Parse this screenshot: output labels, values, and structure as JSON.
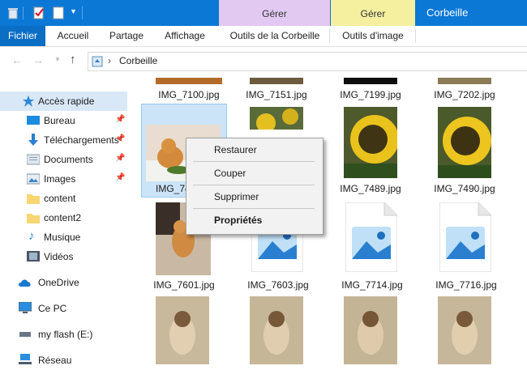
{
  "titlebar": {
    "manage_tabs": [
      {
        "label": "Gérer",
        "color": "#e2c9f2"
      },
      {
        "label": "Gérer",
        "color": "#f4f0a0"
      }
    ],
    "window_title": "Corbeille"
  },
  "ribbon": {
    "file_tab": "Fichier",
    "tabs": [
      "Accueil",
      "Partage",
      "Affichage",
      "Outils de la Corbeille",
      "Outils d'image"
    ]
  },
  "address": {
    "location": "Corbeille"
  },
  "nav": {
    "items": [
      {
        "label": "Accès rapide",
        "icon": "star-icon",
        "pinned": false
      },
      {
        "label": "Bureau",
        "icon": "desktop-folder-icon",
        "pinned": true
      },
      {
        "label": "Téléchargements",
        "icon": "download-arrow-icon",
        "pinned": true
      },
      {
        "label": "Documents",
        "icon": "documents-folder-icon",
        "pinned": true
      },
      {
        "label": "Images",
        "icon": "pictures-folder-icon",
        "pinned": true
      },
      {
        "label": "content",
        "icon": "folder-icon",
        "pinned": false
      },
      {
        "label": "content2",
        "icon": "folder-icon",
        "pinned": false
      },
      {
        "label": "Musique",
        "icon": "music-note-icon",
        "pinned": false
      },
      {
        "label": "Vidéos",
        "icon": "video-folder-icon",
        "pinned": false
      },
      {
        "label": "OneDrive",
        "icon": "cloud-icon",
        "pinned": false
      },
      {
        "label": "Ce PC",
        "icon": "monitor-icon",
        "pinned": false
      },
      {
        "label": "my flash (E:)",
        "icon": "usb-drive-icon",
        "pinned": false
      },
      {
        "label": "Réseau",
        "icon": "network-icon",
        "pinned": false
      }
    ]
  },
  "files": {
    "row1": [
      "IMG_7100.jpg",
      "IMG_7151.jpg",
      "IMG_7199.jpg",
      "IMG_7202.jpg"
    ],
    "row2": [
      "IMG_74",
      "",
      "IMG_7489.jpg",
      "IMG_7490.jpg"
    ],
    "row3": [
      "IMG_7601.jpg",
      "IMG_7603.jpg",
      "IMG_7714.jpg",
      "IMG_7716.jpg"
    ]
  },
  "context_menu": {
    "items": [
      "Restaurer",
      "Couper",
      "Supprimer",
      "Propriétés"
    ]
  }
}
